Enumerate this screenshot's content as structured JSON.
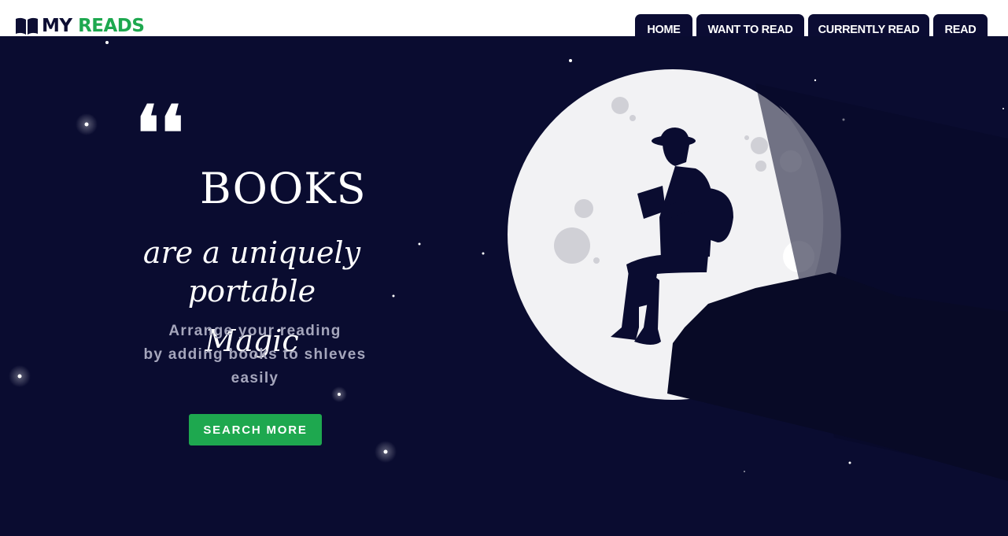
{
  "brand": {
    "part1": "MY",
    "part2": "READS",
    "icon": "open-book-icon",
    "colors": {
      "dark": "#0d0e33",
      "accent": "#1ea84f"
    }
  },
  "nav": {
    "tabs": [
      {
        "label": "HOME"
      },
      {
        "label": "WANT TO READ"
      },
      {
        "label": "CURRENTLY READ"
      },
      {
        "label": "READ"
      }
    ]
  },
  "hero": {
    "quote_mark": "❛❛",
    "books_word": "BOOKS",
    "tagline_lines": [
      "are a uniquely",
      "portable",
      "Magic"
    ],
    "subtext_lines": [
      "Arrange your reading",
      "by adding books to shleves",
      "easily"
    ],
    "cta_label": "SEARCH MORE",
    "illustration": "moon-reader-illustration",
    "colors": {
      "background": "#0a0c30",
      "moon": "#f2f2f4",
      "silhouette": "#080a26",
      "button": "#1ea84f"
    }
  }
}
